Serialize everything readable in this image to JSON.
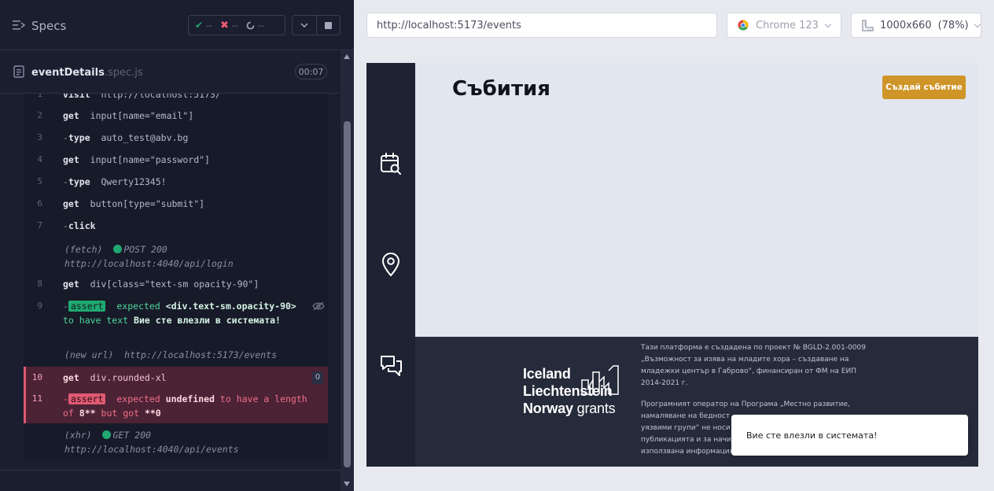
{
  "runner": {
    "specs_label": "Specs",
    "stats": {
      "passed": "--",
      "failed": "--",
      "pending": "--"
    },
    "spec": {
      "name": "eventDetails",
      "ext": ".spec.js",
      "duration": "00:07"
    },
    "commands": [
      {
        "num": "1",
        "name": "visit",
        "arg": "http://localhost:5173/"
      },
      {
        "num": "2",
        "name": "get",
        "arg": "input[name=\"email\"]"
      },
      {
        "num": "3",
        "name": "type",
        "arg": "auto_test@abv.bg"
      },
      {
        "num": "4",
        "name": "get",
        "arg": "input[name=\"password\"]"
      },
      {
        "num": "5",
        "name": "type",
        "arg": "Qwerty12345!"
      },
      {
        "num": "6",
        "name": "get",
        "arg": "button[type=\"submit\"]"
      },
      {
        "num": "7",
        "name": "click",
        "arg": ""
      },
      {
        "num": "8",
        "name": "get",
        "arg": "div[class=\"text-sm opacity-90\"]"
      },
      {
        "num": "10",
        "name": "get",
        "arg": "div.rounded-xl"
      }
    ],
    "fetch": {
      "label": "(fetch)",
      "status": "POST 200",
      "url": "http://localhost:4040/api/login"
    },
    "assert1": {
      "num": "9",
      "badge": "assert",
      "t1": "expected",
      "v1": "<div.text-sm.opacity-90>",
      "t2": "to have text",
      "v2": "Вие сте влезли в системата!"
    },
    "new_url": {
      "label": "(new url)",
      "url": "http://localhost:5173/events"
    },
    "count_badge": "0",
    "assert2": {
      "num": "11",
      "badge": "assert",
      "t1": "expected",
      "v1": "undefined",
      "t2": "to have a length of",
      "v2": "8",
      "t3": "but got",
      "v3": "0"
    },
    "xhr": {
      "label": "(xhr)",
      "status": "GET 200",
      "url": "http://localhost:4040/api/events"
    }
  },
  "preview": {
    "url": "http://localhost:5173/events",
    "browser": "Chrome 123",
    "viewport": "1000x660",
    "zoom": "(78%)"
  },
  "app": {
    "page_title": "Събития",
    "create_button": "Създай събитие",
    "nav_icons": [
      "calendar-search-icon",
      "location-pin-icon",
      "chat-icon"
    ],
    "logo": {
      "line1": "Iceland",
      "line2": "Liechtenstein",
      "line3a": "Norway",
      "line3b": "grants"
    },
    "footer_p1": [
      "Тази платформа е създадена по проект № BGLD-2.001-0009",
      "„Възможност за изява на младите хора – създаване на",
      "младежки център в Габрово“, финансиран от ФМ на ЕИП",
      "2014-2021 г."
    ],
    "footer_p2": [
      "Програмният оператор на Програма „Местно развитие,",
      "намаляване на бедност",
      "уязвими групи“ не носи о",
      "публикацията и за начин",
      "използвана информация"
    ],
    "toast": "Вие сте влезли в системата!"
  },
  "colors": {
    "pass": "#1fa971",
    "fail": "#e05a72",
    "accent": "#cf9528",
    "sidebar": "#1e2333"
  }
}
